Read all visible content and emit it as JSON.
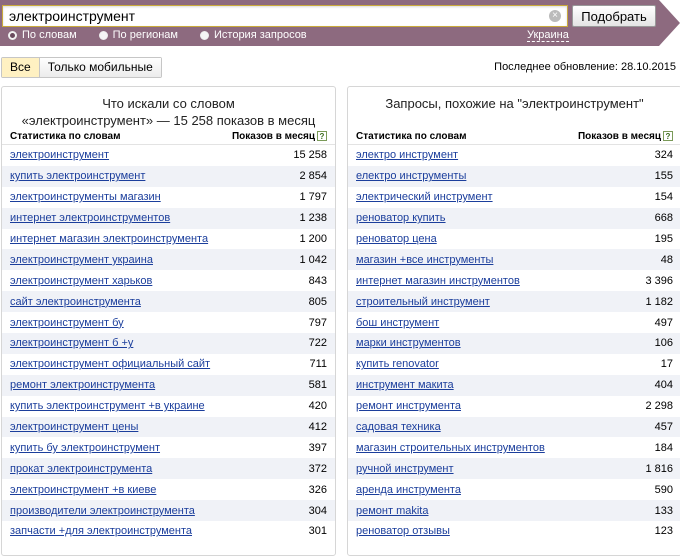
{
  "search": {
    "value": "электроинструмент",
    "submit_label": "Подобрать"
  },
  "modes": [
    {
      "label": "По словам",
      "selected": true
    },
    {
      "label": "По регионам",
      "selected": false
    },
    {
      "label": "История запросов",
      "selected": false
    }
  ],
  "region": "Украина",
  "filters": [
    {
      "label": "Все",
      "active": true
    },
    {
      "label": "Только мобильные",
      "active": false
    }
  ],
  "updated": "Последнее обновление: 28.10.2015",
  "colors": {
    "header": "#8d6a7f",
    "link": "#1b3e9c",
    "stripe": "#f0f2f7",
    "accent": "#fff1c2"
  },
  "left_panel": {
    "title_line1": "Что искали со словом",
    "title_line2": "«электроинструмент» — 15 258 показов в месяц",
    "col_words": "Статистика по словам",
    "col_count": "Показов в месяц",
    "rows": [
      {
        "q": "электроинструмент",
        "n": "15 258"
      },
      {
        "q": "купить электроинструмент",
        "n": "2 854"
      },
      {
        "q": "электроинструменты магазин",
        "n": "1 797"
      },
      {
        "q": "интернет электроинструментов",
        "n": "1 238"
      },
      {
        "q": "интернет магазин электроинструмента",
        "n": "1 200"
      },
      {
        "q": "электроинструмент украина",
        "n": "1 042"
      },
      {
        "q": "электроинструмент харьков",
        "n": "843"
      },
      {
        "q": "сайт электроинструмента",
        "n": "805"
      },
      {
        "q": "электроинструмент бу",
        "n": "797"
      },
      {
        "q": "электроинструмент б +у",
        "n": "722"
      },
      {
        "q": "электроинструмент официальный сайт",
        "n": "711"
      },
      {
        "q": "ремонт электроинструмента",
        "n": "581"
      },
      {
        "q": "купить электроинструмент +в украине",
        "n": "420"
      },
      {
        "q": "электроинструмент цены",
        "n": "412"
      },
      {
        "q": "купить бу электроинструмент",
        "n": "397"
      },
      {
        "q": "прокат электроинструмента",
        "n": "372"
      },
      {
        "q": "электроинструмент +в киеве",
        "n": "326"
      },
      {
        "q": "производители электроинструмента",
        "n": "304"
      },
      {
        "q": "запчасти +для электроинструмента",
        "n": "301"
      }
    ]
  },
  "right_panel": {
    "title": "Запросы, похожие на \"электроинструмент\"",
    "col_words": "Статистика по словам",
    "col_count": "Показов в месяц",
    "rows": [
      {
        "q": "электро инструмент",
        "n": "324"
      },
      {
        "q": "електро инструменты",
        "n": "155"
      },
      {
        "q": "электрический инструмент",
        "n": "154"
      },
      {
        "q": "реноватор купить",
        "n": "668"
      },
      {
        "q": "реноватор цена",
        "n": "195"
      },
      {
        "q": "магазин +все инструменты",
        "n": "48"
      },
      {
        "q": "интернет магазин инструментов",
        "n": "3 396"
      },
      {
        "q": "строительный инструмент",
        "n": "1 182"
      },
      {
        "q": "бош инструмент",
        "n": "497"
      },
      {
        "q": "марки инструментов",
        "n": "106"
      },
      {
        "q": "купить renovator",
        "n": "17"
      },
      {
        "q": "инструмент макита",
        "n": "404"
      },
      {
        "q": "ремонт инструмента",
        "n": "2 298"
      },
      {
        "q": "садовая техника",
        "n": "457"
      },
      {
        "q": "магазин строительных инструментов",
        "n": "184"
      },
      {
        "q": "ручной инструмент",
        "n": "1 816"
      },
      {
        "q": "аренда инструмента",
        "n": "590"
      },
      {
        "q": "ремонт makita",
        "n": "133"
      },
      {
        "q": "реноватор отзывы",
        "n": "123"
      }
    ]
  }
}
